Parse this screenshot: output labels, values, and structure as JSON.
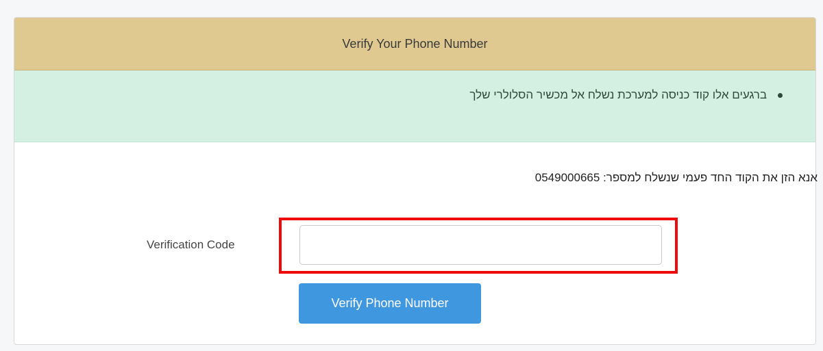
{
  "header": {
    "title": "Verify Your Phone Number"
  },
  "alert": {
    "items": [
      "ברגעים אלו קוד כניסה למערכת נשלח אל מכשיר הסלולרי שלך"
    ]
  },
  "instruction": "אנא הזן את הקוד החד פעמי שנשלח למספר: 0549000665",
  "form": {
    "label": "Verification Code",
    "value": "",
    "placeholder": ""
  },
  "button": {
    "label": "Verify Phone Number"
  },
  "colors": {
    "header_bg": "#dfc991",
    "alert_bg": "#d4f0e2",
    "button_bg": "#3f97df",
    "highlight": "#ee0a0a"
  }
}
